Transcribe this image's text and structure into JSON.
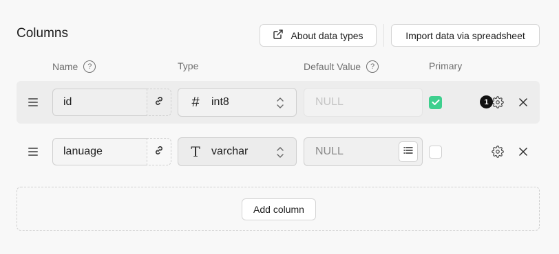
{
  "section": {
    "title": "Columns"
  },
  "toolbar": {
    "about_label": "About data types",
    "about_icon": "external-link-icon",
    "import_label": "Import data via spreadsheet"
  },
  "headers": {
    "name": "Name",
    "type": "Type",
    "default_value": "Default Value",
    "primary": "Primary",
    "help_glyph": "?"
  },
  "rows": [
    {
      "name": "id",
      "type": "int8",
      "type_glyph": "#",
      "type_icon": "hash-icon",
      "default_placeholder": "NULL",
      "primary": true,
      "badge": "1"
    },
    {
      "name": "lanuage",
      "type": "varchar",
      "type_glyph": "T",
      "type_icon": "text-type-icon",
      "default_placeholder": "NULL",
      "primary": false
    }
  ],
  "add_column": {
    "label": "Add column"
  },
  "colors": {
    "accent_green": "#3ecf8e",
    "background": "#f8f8f8",
    "active_row": "#ededed"
  }
}
